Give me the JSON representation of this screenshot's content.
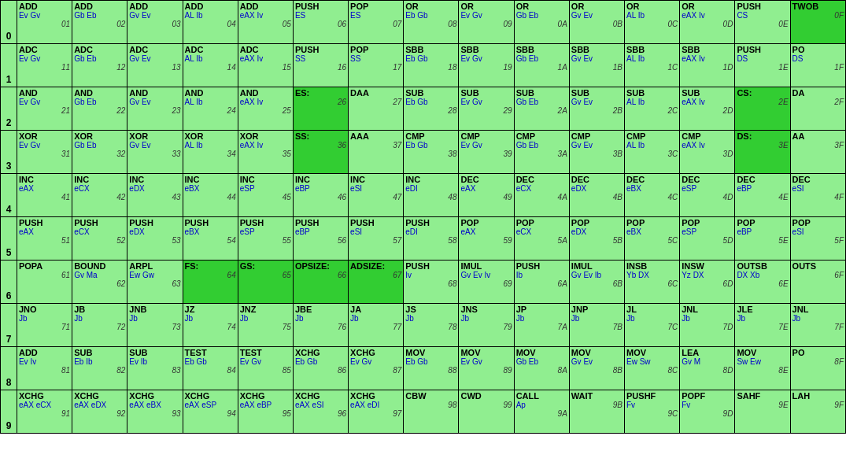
{
  "rows": [
    [
      {
        "top": "ADD",
        "mid": "Ev Gv",
        "bot": "01",
        "dark": false
      },
      {
        "top": "ADD",
        "mid": "Gb Eb",
        "bot": "02",
        "dark": false
      },
      {
        "top": "ADD",
        "mid": "Gv Ev",
        "bot": "03",
        "dark": false
      },
      {
        "top": "ADD",
        "mid": "AL Ib",
        "bot": "04",
        "dark": false
      },
      {
        "top": "ADD",
        "mid": "eAX Iv",
        "bot": "05",
        "dark": false
      },
      {
        "top": "PUSH",
        "mid": "ES",
        "bot": "06",
        "dark": false
      },
      {
        "top": "POP",
        "mid": "ES",
        "bot": "07",
        "dark": false
      },
      {
        "top": "OR",
        "mid": "Eb Gb",
        "bot": "08",
        "dark": false
      },
      {
        "top": "OR",
        "mid": "Ev Gv",
        "bot": "09",
        "dark": false
      },
      {
        "top": "OR",
        "mid": "Gb Eb",
        "bot": "0A",
        "dark": false
      },
      {
        "top": "OR",
        "mid": "Gv Ev",
        "bot": "0B",
        "dark": false
      },
      {
        "top": "OR",
        "mid": "AL Ib",
        "bot": "0C",
        "dark": false
      },
      {
        "top": "OR",
        "mid": "eAX Iv",
        "bot": "0D",
        "dark": false
      },
      {
        "top": "PUSH",
        "mid": "CS",
        "bot": "0E",
        "dark": false
      },
      {
        "top": "TWOB",
        "mid": "",
        "bot": "0F",
        "dark": true
      }
    ],
    [
      {
        "top": "ADC",
        "mid": "Ev Gv",
        "bot": "11",
        "dark": false
      },
      {
        "top": "ADC",
        "mid": "Gb Eb",
        "bot": "12",
        "dark": false
      },
      {
        "top": "ADC",
        "mid": "Gv Ev",
        "bot": "13",
        "dark": false
      },
      {
        "top": "ADC",
        "mid": "AL Ib",
        "bot": "14",
        "dark": false
      },
      {
        "top": "ADC",
        "mid": "eAX Iv",
        "bot": "15",
        "dark": false
      },
      {
        "top": "PUSH",
        "mid": "SS",
        "bot": "16",
        "dark": false
      },
      {
        "top": "POP",
        "mid": "SS",
        "bot": "17",
        "dark": false
      },
      {
        "top": "SBB",
        "mid": "Eb Gb",
        "bot": "18",
        "dark": false
      },
      {
        "top": "SBB",
        "mid": "Ev Gv",
        "bot": "19",
        "dark": false
      },
      {
        "top": "SBB",
        "mid": "Gb Eb",
        "bot": "1A",
        "dark": false
      },
      {
        "top": "SBB",
        "mid": "Gv Ev",
        "bot": "1B",
        "dark": false
      },
      {
        "top": "SBB",
        "mid": "AL Ib",
        "bot": "1C",
        "dark": false
      },
      {
        "top": "SBB",
        "mid": "eAX Iv",
        "bot": "1D",
        "dark": false
      },
      {
        "top": "PUSH",
        "mid": "DS",
        "bot": "1E",
        "dark": false
      },
      {
        "top": "PO",
        "mid": "DS",
        "bot": "1F",
        "dark": false
      }
    ],
    [
      {
        "top": "AND",
        "mid": "Ev Gv",
        "bot": "21",
        "dark": false
      },
      {
        "top": "AND",
        "mid": "Gb Eb",
        "bot": "22",
        "dark": false
      },
      {
        "top": "AND",
        "mid": "Gv Ev",
        "bot": "23",
        "dark": false
      },
      {
        "top": "AND",
        "mid": "AL Ib",
        "bot": "24",
        "dark": false
      },
      {
        "top": "AND",
        "mid": "eAX Iv",
        "bot": "25",
        "dark": false
      },
      {
        "top": "ES:",
        "mid": "",
        "bot": "26",
        "dark": true
      },
      {
        "top": "DAA",
        "mid": "",
        "bot": "27",
        "dark": false
      },
      {
        "top": "SUB",
        "mid": "Eb Gb",
        "bot": "28",
        "dark": false
      },
      {
        "top": "SUB",
        "mid": "Ev Gv",
        "bot": "29",
        "dark": false
      },
      {
        "top": "SUB",
        "mid": "Gb Eb",
        "bot": "2A",
        "dark": false
      },
      {
        "top": "SUB",
        "mid": "Gv Ev",
        "bot": "2B",
        "dark": false
      },
      {
        "top": "SUB",
        "mid": "AL Ib",
        "bot": "2C",
        "dark": false
      },
      {
        "top": "SUB",
        "mid": "eAX Iv",
        "bot": "2D",
        "dark": false
      },
      {
        "top": "CS:",
        "mid": "",
        "bot": "2E",
        "dark": true
      },
      {
        "top": "DA",
        "mid": "",
        "bot": "2F",
        "dark": false
      }
    ],
    [
      {
        "top": "XOR",
        "mid": "Ev Gv",
        "bot": "31",
        "dark": false
      },
      {
        "top": "XOR",
        "mid": "Gb Eb",
        "bot": "32",
        "dark": false
      },
      {
        "top": "XOR",
        "mid": "Gv Ev",
        "bot": "33",
        "dark": false
      },
      {
        "top": "XOR",
        "mid": "AL Ib",
        "bot": "34",
        "dark": false
      },
      {
        "top": "XOR",
        "mid": "eAX Iv",
        "bot": "35",
        "dark": false
      },
      {
        "top": "SS:",
        "mid": "",
        "bot": "36",
        "dark": true
      },
      {
        "top": "AAA",
        "mid": "",
        "bot": "37",
        "dark": false
      },
      {
        "top": "CMP",
        "mid": "Eb Gb",
        "bot": "38",
        "dark": false
      },
      {
        "top": "CMP",
        "mid": "Ev Gv",
        "bot": "39",
        "dark": false
      },
      {
        "top": "CMP",
        "mid": "Gb Eb",
        "bot": "3A",
        "dark": false
      },
      {
        "top": "CMP",
        "mid": "Gv Ev",
        "bot": "3B",
        "dark": false
      },
      {
        "top": "CMP",
        "mid": "AL Ib",
        "bot": "3C",
        "dark": false
      },
      {
        "top": "CMP",
        "mid": "eAX Iv",
        "bot": "3D",
        "dark": false
      },
      {
        "top": "DS:",
        "mid": "",
        "bot": "3E",
        "dark": true
      },
      {
        "top": "AA",
        "mid": "",
        "bot": "3F",
        "dark": false
      }
    ],
    [
      {
        "top": "INC",
        "mid": "eAX",
        "bot": "41",
        "dark": false
      },
      {
        "top": "INC",
        "mid": "eCX",
        "bot": "42",
        "dark": false
      },
      {
        "top": "INC",
        "mid": "eDX",
        "bot": "43",
        "dark": false
      },
      {
        "top": "INC",
        "mid": "eBX",
        "bot": "44",
        "dark": false
      },
      {
        "top": "INC",
        "mid": "eSP",
        "bot": "45",
        "dark": false
      },
      {
        "top": "INC",
        "mid": "eBP",
        "bot": "46",
        "dark": false
      },
      {
        "top": "INC",
        "mid": "eSI",
        "bot": "47",
        "dark": false
      },
      {
        "top": "INC",
        "mid": "eDI",
        "bot": "48",
        "dark": false
      },
      {
        "top": "DEC",
        "mid": "eAX",
        "bot": "49",
        "dark": false
      },
      {
        "top": "DEC",
        "mid": "eCX",
        "bot": "4A",
        "dark": false
      },
      {
        "top": "DEC",
        "mid": "eDX",
        "bot": "4B",
        "dark": false
      },
      {
        "top": "DEC",
        "mid": "eBX",
        "bot": "4C",
        "dark": false
      },
      {
        "top": "DEC",
        "mid": "eSP",
        "bot": "4D",
        "dark": false
      },
      {
        "top": "DEC",
        "mid": "eBP",
        "bot": "4E",
        "dark": false
      },
      {
        "top": "DEC",
        "mid": "eSI",
        "bot": "4F",
        "dark": false
      }
    ],
    [
      {
        "top": "PUSH",
        "mid": "eAX",
        "bot": "51",
        "dark": false
      },
      {
        "top": "PUSH",
        "mid": "eCX",
        "bot": "52",
        "dark": false
      },
      {
        "top": "PUSH",
        "mid": "eDX",
        "bot": "53",
        "dark": false
      },
      {
        "top": "PUSH",
        "mid": "eBX",
        "bot": "54",
        "dark": false
      },
      {
        "top": "PUSH",
        "mid": "eSP",
        "bot": "55",
        "dark": false
      },
      {
        "top": "PUSH",
        "mid": "eBP",
        "bot": "56",
        "dark": false
      },
      {
        "top": "PUSH",
        "mid": "eSI",
        "bot": "57",
        "dark": false
      },
      {
        "top": "PUSH",
        "mid": "eDI",
        "bot": "58",
        "dark": false
      },
      {
        "top": "POP",
        "mid": "eAX",
        "bot": "59",
        "dark": false
      },
      {
        "top": "POP",
        "mid": "eCX",
        "bot": "5A",
        "dark": false
      },
      {
        "top": "POP",
        "mid": "eDX",
        "bot": "5B",
        "dark": false
      },
      {
        "top": "POP",
        "mid": "eBX",
        "bot": "5C",
        "dark": false
      },
      {
        "top": "POP",
        "mid": "eSP",
        "bot": "5D",
        "dark": false
      },
      {
        "top": "POP",
        "mid": "eBP",
        "bot": "5E",
        "dark": false
      },
      {
        "top": "POP",
        "mid": "eSI",
        "bot": "5F",
        "dark": false
      }
    ],
    [
      {
        "top": "POPA",
        "mid": "",
        "bot": "61",
        "dark": false
      },
      {
        "top": "BOUND",
        "mid": "Gv Ma",
        "bot": "62",
        "dark": false
      },
      {
        "top": "ARPL",
        "mid": "Ew Gw",
        "bot": "63",
        "dark": false
      },
      {
        "top": "FS:",
        "mid": "",
        "bot": "64",
        "dark": true
      },
      {
        "top": "GS:",
        "mid": "",
        "bot": "65",
        "dark": true
      },
      {
        "top": "OPSIZE:",
        "mid": "",
        "bot": "66",
        "dark": true
      },
      {
        "top": "ADSIZE:",
        "mid": "",
        "bot": "67",
        "dark": true
      },
      {
        "top": "PUSH",
        "mid": "Iv",
        "bot": "68",
        "dark": false
      },
      {
        "top": "IMUL",
        "mid": "Gv Ev Iv",
        "bot": "69",
        "dark": false
      },
      {
        "top": "PUSH",
        "mid": "Ib",
        "bot": "6A",
        "dark": false
      },
      {
        "top": "IMUL",
        "mid": "Gv Ev Ib",
        "bot": "6B",
        "dark": false
      },
      {
        "top": "INSB",
        "mid": "Yb DX",
        "bot": "6C",
        "dark": false
      },
      {
        "top": "INSW",
        "mid": "Yz DX",
        "bot": "6D",
        "dark": false
      },
      {
        "top": "OUTSB",
        "mid": "DX Xb",
        "bot": "6E",
        "dark": false
      },
      {
        "top": "OUTS",
        "mid": "",
        "bot": "6F",
        "dark": false
      }
    ],
    [
      {
        "top": "JNO",
        "mid": "Jb",
        "bot": "71",
        "dark": false
      },
      {
        "top": "JB",
        "mid": "Jb",
        "bot": "72",
        "dark": false
      },
      {
        "top": "JNB",
        "mid": "Jb",
        "bot": "73",
        "dark": false
      },
      {
        "top": "JZ",
        "mid": "Jb",
        "bot": "74",
        "dark": false
      },
      {
        "top": "JNZ",
        "mid": "Jb",
        "bot": "75",
        "dark": false
      },
      {
        "top": "JBE",
        "mid": "Jb",
        "bot": "76",
        "dark": false
      },
      {
        "top": "JA",
        "mid": "Jb",
        "bot": "77",
        "dark": false
      },
      {
        "top": "JS",
        "mid": "Jb",
        "bot": "78",
        "dark": false
      },
      {
        "top": "JNS",
        "mid": "Jb",
        "bot": "79",
        "dark": false
      },
      {
        "top": "JP",
        "mid": "Jb",
        "bot": "7A",
        "dark": false
      },
      {
        "top": "JNP",
        "mid": "Jb",
        "bot": "7B",
        "dark": false
      },
      {
        "top": "JL",
        "mid": "Jb",
        "bot": "7C",
        "dark": false
      },
      {
        "top": "JNL",
        "mid": "Jb",
        "bot": "7D",
        "dark": false
      },
      {
        "top": "JLE",
        "mid": "Jb",
        "bot": "7E",
        "dark": false
      },
      {
        "top": "JNL",
        "mid": "Jb",
        "bot": "7F",
        "dark": false
      }
    ],
    [
      {
        "top": "ADD",
        "mid": "Ev Iv",
        "bot": "81",
        "dark": false
      },
      {
        "top": "SUB",
        "mid": "Eb Ib",
        "bot": "82",
        "dark": false
      },
      {
        "top": "SUB",
        "mid": "Ev Ib",
        "bot": "83",
        "dark": false
      },
      {
        "top": "TEST",
        "mid": "Eb Gb",
        "bot": "84",
        "dark": false
      },
      {
        "top": "TEST",
        "mid": "Ev Gv",
        "bot": "85",
        "dark": false
      },
      {
        "top": "XCHG",
        "mid": "Eb Gb",
        "bot": "86",
        "dark": false
      },
      {
        "top": "XCHG",
        "mid": "Ev Gv",
        "bot": "87",
        "dark": false
      },
      {
        "top": "MOV",
        "mid": "Eb Gb",
        "bot": "88",
        "dark": false
      },
      {
        "top": "MOV",
        "mid": "Ev Gv",
        "bot": "89",
        "dark": false
      },
      {
        "top": "MOV",
        "mid": "Gb Eb",
        "bot": "8A",
        "dark": false
      },
      {
        "top": "MOV",
        "mid": "Gv Ev",
        "bot": "8B",
        "dark": false
      },
      {
        "top": "MOV",
        "mid": "Ew Sw",
        "bot": "8C",
        "dark": false
      },
      {
        "top": "LEA",
        "mid": "Gv M",
        "bot": "8D",
        "dark": false
      },
      {
        "top": "MOV",
        "mid": "Sw Ew",
        "bot": "8E",
        "dark": false
      },
      {
        "top": "PO",
        "mid": "",
        "bot": "8F",
        "dark": false
      }
    ],
    [
      {
        "top": "XCHG",
        "mid": "eAX eCX",
        "bot": "91",
        "dark": false
      },
      {
        "top": "XCHG",
        "mid": "eAX eDX",
        "bot": "92",
        "dark": false
      },
      {
        "top": "XCHG",
        "mid": "eAX eBX",
        "bot": "93",
        "dark": false
      },
      {
        "top": "XCHG",
        "mid": "eAX eSP",
        "bot": "94",
        "dark": false
      },
      {
        "top": "XCHG",
        "mid": "eAX eBP",
        "bot": "95",
        "dark": false
      },
      {
        "top": "XCHG",
        "mid": "eAX eSI",
        "bot": "96",
        "dark": false
      },
      {
        "top": "XCHG",
        "mid": "eAX eDI",
        "bot": "97",
        "dark": false
      },
      {
        "top": "CBW",
        "mid": "",
        "bot": "98",
        "dark": false
      },
      {
        "top": "CWD",
        "mid": "",
        "bot": "99",
        "dark": false
      },
      {
        "top": "CALL",
        "mid": "Ap",
        "bot": "9A",
        "dark": false
      },
      {
        "top": "WAIT",
        "mid": "",
        "bot": "9B",
        "dark": false
      },
      {
        "top": "PUSHF",
        "mid": "Fv",
        "bot": "9C",
        "dark": false
      },
      {
        "top": "POPF",
        "mid": "Fv",
        "bot": "9D",
        "dark": false
      },
      {
        "top": "SAHF",
        "mid": "",
        "bot": "9E",
        "dark": false
      },
      {
        "top": "LAH",
        "mid": "",
        "bot": "9F",
        "dark": false
      }
    ]
  ],
  "first_col_labels": [
    "0",
    "1",
    "2",
    "3",
    "4",
    "5",
    "6",
    "7",
    "8",
    "9"
  ],
  "colors": {
    "light_green": "#90ee90",
    "dark_green": "#32cd32",
    "white": "#ffffff",
    "border": "#000000"
  }
}
